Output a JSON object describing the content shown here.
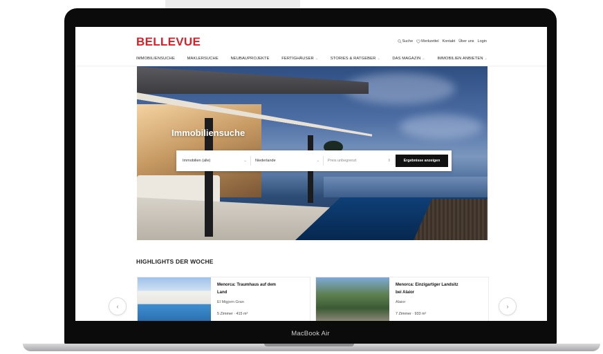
{
  "device": {
    "model_label": "MacBook Air"
  },
  "header": {
    "logo": "BELLEVUE",
    "util_links": [
      {
        "label": "Suche",
        "icon": "search-icon"
      },
      {
        "label": "Merkzettel",
        "icon": "heart-icon"
      },
      {
        "label": "Kontakt"
      },
      {
        "label": "Über uns"
      },
      {
        "label": "Login"
      }
    ],
    "nav": [
      {
        "label": "IMMOBILIENSUCHE",
        "dropdown": false
      },
      {
        "label": "MAKLERSUCHE",
        "dropdown": false
      },
      {
        "label": "NEUBAUPROJEKTE",
        "dropdown": false
      },
      {
        "label": "FERTIGHÄUSER",
        "dropdown": true
      },
      {
        "label": "STORIES & RATGEBER",
        "dropdown": true
      },
      {
        "label": "DAS MAGAZIN",
        "dropdown": true
      },
      {
        "label": "IMMOBILIEN ANBIETEN",
        "dropdown": true
      }
    ]
  },
  "hero": {
    "title": "Immobiliensuche",
    "search": {
      "type_value": "Immobilien (alle)",
      "country_value": "Niederlande",
      "price_placeholder": "Preis unbegrenzt",
      "submit_label": "Ergebnisse anzeigen"
    }
  },
  "highlights": {
    "title": "HIGHLIGHTS DER WOCHE",
    "cards": [
      {
        "title": "Menorca: Traumhaus auf dem Land",
        "location": "El Migjorn Gran",
        "meta": "5 Zimmer · 415 m²"
      },
      {
        "title": "Menorca: Einzigartiger Landsitz bei Alaior",
        "location": "Alaior",
        "meta": "7 Zimmer · 933 m²"
      }
    ],
    "prev_icon": "chevron-left-icon",
    "next_icon": "chevron-right-icon"
  },
  "colors": {
    "brand": "#d6202a",
    "button": "#111111"
  }
}
